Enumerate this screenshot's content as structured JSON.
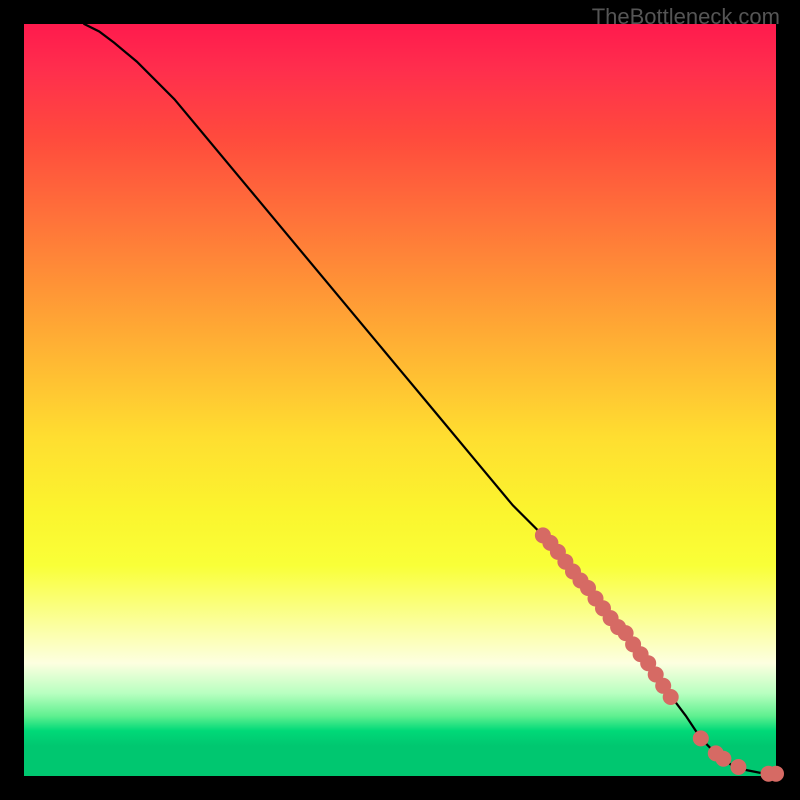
{
  "watermark": "TheBottleneck.com",
  "chart_data": {
    "type": "line",
    "title": "",
    "xlabel": "",
    "ylabel": "",
    "xlim": [
      0,
      100
    ],
    "ylim": [
      0,
      100
    ],
    "curve": {
      "x": [
        8,
        10,
        12,
        15,
        20,
        25,
        30,
        35,
        40,
        45,
        50,
        55,
        60,
        65,
        70,
        75,
        80,
        85,
        88,
        90,
        92,
        94,
        96,
        98,
        100
      ],
      "y": [
        100,
        99,
        97.5,
        95,
        90,
        84,
        78,
        72,
        66,
        60,
        54,
        48,
        42,
        36,
        31,
        25,
        19,
        12,
        8,
        5,
        3,
        1.5,
        0.8,
        0.4,
        0.3
      ]
    },
    "highlight_points": {
      "x": [
        69,
        70,
        71,
        72,
        73,
        74,
        75,
        76,
        77,
        78,
        79,
        80,
        81,
        82,
        83,
        84,
        85,
        86,
        90,
        92,
        93,
        95,
        99,
        100
      ],
      "y": [
        32,
        31,
        29.8,
        28.5,
        27.2,
        26,
        25,
        23.6,
        22.3,
        21,
        19.8,
        19,
        17.5,
        16.2,
        15,
        13.5,
        12,
        10.5,
        5,
        3,
        2.3,
        1.2,
        0.3,
        0.3
      ]
    },
    "gradient_stops": [
      {
        "pos": 0,
        "color": "#ff1a4d"
      },
      {
        "pos": 50,
        "color": "#ffde30"
      },
      {
        "pos": 80,
        "color": "#fbffa0"
      },
      {
        "pos": 95,
        "color": "#00d978"
      }
    ]
  }
}
